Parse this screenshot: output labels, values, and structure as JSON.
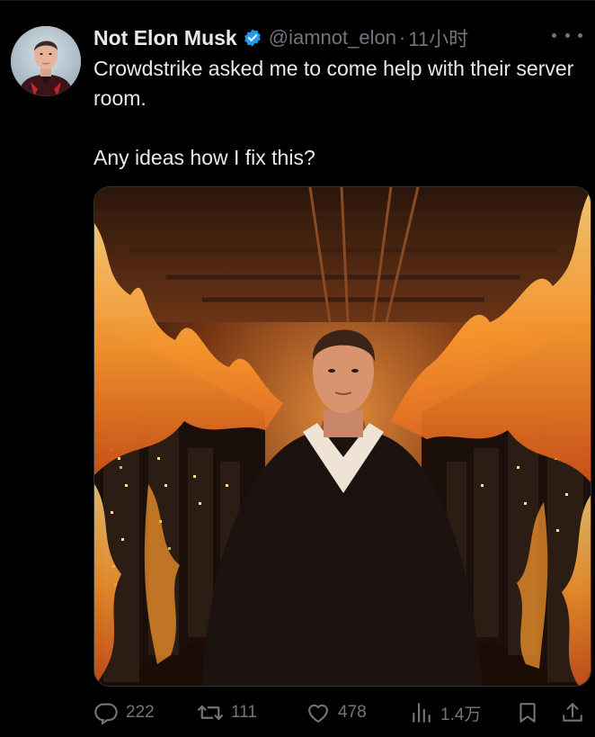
{
  "tweet": {
    "author_name": "Not Elon Musk",
    "handle": "@iamnot_elon",
    "separator": "·",
    "time": "11小时",
    "verified": true,
    "text_line1": "Crowdstrike asked me to come help with their server room.",
    "text_line2": "Any ideas how I fix this?"
  },
  "actions": {
    "reply_count": "222",
    "retweet_count": "111",
    "like_count": "478",
    "views_count": "1.4万"
  },
  "colors": {
    "background": "#000000",
    "text": "#e7e9ea",
    "muted": "#71767b",
    "verified_badge": "#1d9bf0"
  },
  "icons": [
    "verified-badge-icon",
    "more-options-icon",
    "reply-icon",
    "retweet-icon",
    "like-icon",
    "views-icon",
    "bookmark-icon",
    "share-icon"
  ]
}
